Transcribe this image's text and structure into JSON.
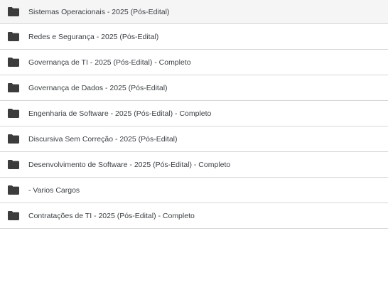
{
  "colors": {
    "folder_icon": "#3c3c3c",
    "text": "#3c4043",
    "divider": "#d6d6d6",
    "background": "#ffffff"
  },
  "folders": [
    {
      "label": "Sistemas Operacionais - 2025 (Pós-Edital)",
      "icon": "folder-icon"
    },
    {
      "label": "Redes e Segurança - 2025 (Pós-Edital)",
      "icon": "folder-icon"
    },
    {
      "label": "Governança de TI - 2025 (Pós-Edital) - Completo",
      "icon": "folder-icon"
    },
    {
      "label": "Governança de Dados - 2025 (Pós-Edital)",
      "icon": "folder-icon"
    },
    {
      "label": "Engenharia de Software - 2025 (Pós-Edital) - Completo",
      "icon": "folder-icon"
    },
    {
      "label": "Discursiva Sem Correção - 2025 (Pós-Edital)",
      "icon": "folder-icon"
    },
    {
      "label": "Desenvolvimento de Software - 2025 (Pós-Edital) - Completo",
      "icon": "folder-icon"
    },
    {
      "label": "- Varios Cargos",
      "icon": "folder-icon"
    },
    {
      "label": "Contratações de TI - 2025 (Pós-Edital) - Completo",
      "icon": "folder-icon"
    }
  ]
}
